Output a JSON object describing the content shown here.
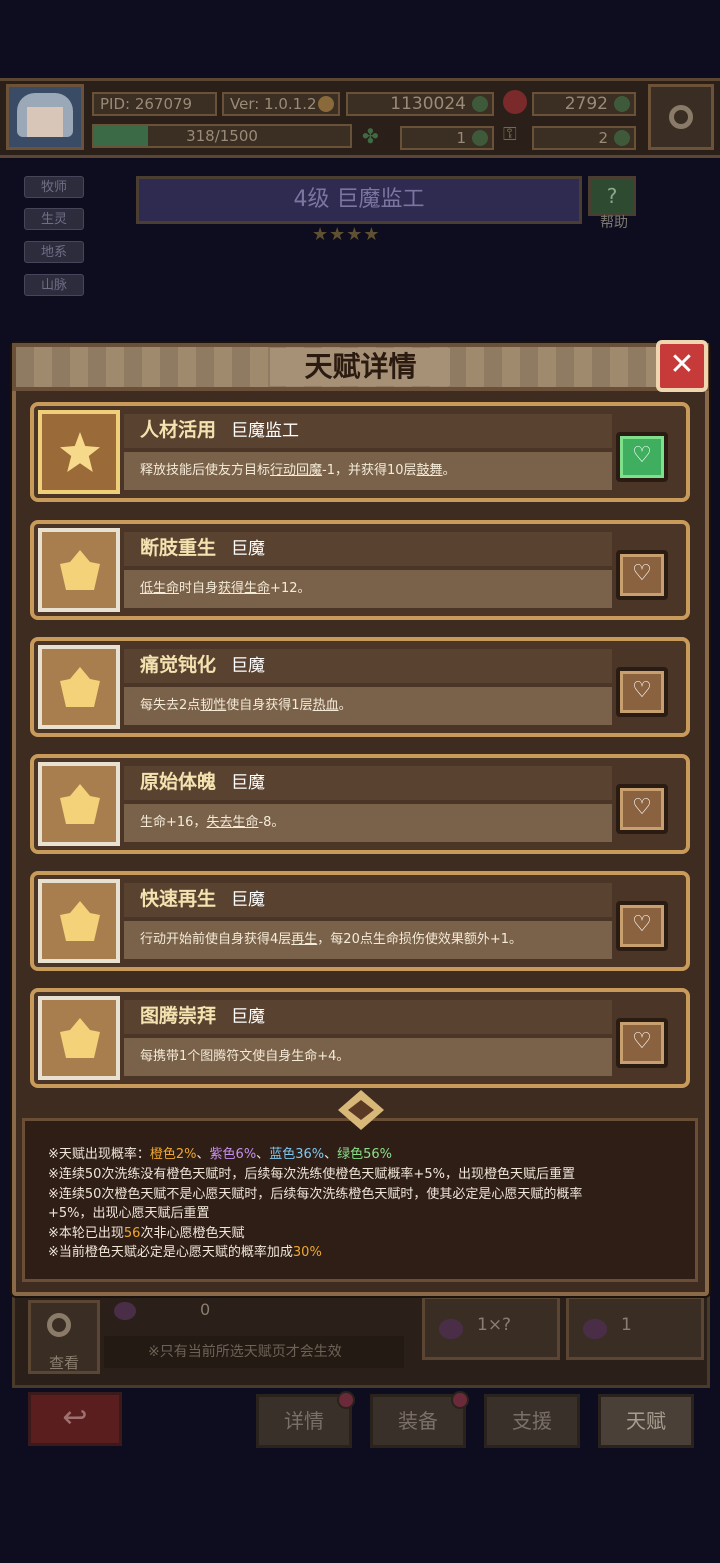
{
  "header": {
    "pid": "PID: 267079",
    "version": "Ver: 1.0.1.2",
    "gold": "1130024",
    "gems": "2792",
    "xp": "318/1500",
    "xp_fraction": 0.212,
    "clovers": "1",
    "keys": "2"
  },
  "side_tags": [
    "牧师",
    "生灵",
    "地系",
    "山脉"
  ],
  "hero": {
    "title": "4级  巨魔监工",
    "stars": "★★★★",
    "help_label": "帮助"
  },
  "modal": {
    "title": "天赋详情",
    "close_icon": "✕",
    "talents": [
      {
        "name": "人材活用",
        "race": "巨魔监工",
        "desc_pre": "释放技能后使友方目标",
        "desc_u1": "行动回魔",
        "desc_mid": "-1，并获得10层",
        "desc_u2": "鼓舞",
        "desc_post": "。",
        "wish": true
      },
      {
        "name": "断肢重生",
        "race": "巨魔",
        "desc_pre": "",
        "desc_u1": "低生命",
        "desc_mid": "时自身",
        "desc_u2": "获得生命",
        "desc_post": "+12。",
        "wish": false
      },
      {
        "name": "痛觉钝化",
        "race": "巨魔",
        "desc_pre": "每失去2点",
        "desc_u1": "韧性",
        "desc_mid": "使自身获得1层",
        "desc_u2": "热血",
        "desc_post": "。",
        "wish": false
      },
      {
        "name": "原始体魄",
        "race": "巨魔",
        "desc_pre": "生命+16，",
        "desc_u1": "失去生命",
        "desc_mid": "-8。",
        "desc_u2": "",
        "desc_post": "",
        "wish": false
      },
      {
        "name": "快速再生",
        "race": "巨魔",
        "desc_pre": "行动开始前使自身获得4层",
        "desc_u1": "再生",
        "desc_mid": "，每20点生命损伤使效果额外+1。",
        "desc_u2": "",
        "desc_post": "",
        "wish": false
      },
      {
        "name": "图腾崇拜",
        "race": "巨魔",
        "desc_pre": "每携带1个图腾符文使自身生命+4。",
        "desc_u1": "",
        "desc_mid": "",
        "desc_u2": "",
        "desc_post": "",
        "wish": false
      }
    ],
    "info": {
      "line1_pre": "※天赋出现概率：",
      "orange": "橙色2%",
      "sep1": "、",
      "purple": "紫色6%",
      "sep2": "、",
      "blue": "蓝色36%",
      "sep3": "、",
      "green": "绿色56%",
      "line2": "※连续50次洗练没有橙色天赋时，后续每次洗练使橙色天赋概率+5%，出现橙色天赋后重置",
      "line3a": "※连续50次橙色天赋不是心愿天赋时，后续每次洗练橙色天赋时，使其必定是心愿天赋的概率",
      "line3b": "+5%，出现心愿天赋后重置",
      "line4_pre": "※本轮已出现",
      "line4_num": "56",
      "line4_post": "次非心愿橙色天赋",
      "line5_pre": "※当前橙色天赋必定是心愿天赋的概率加成",
      "line5_num": "30%"
    }
  },
  "bottom": {
    "view_label": "查看",
    "pot_count": "0",
    "notice": "※只有当前所选天赋页才会生效",
    "auto_value": "1×?",
    "wash_value": "1",
    "back_icon": "↩",
    "tabs": [
      "详情",
      "装备",
      "支援",
      "天赋"
    ]
  },
  "colors": {
    "accent_orange": "#f0a830",
    "purple": "#c890f0",
    "blue": "#80c8f0",
    "green": "#8ae08a",
    "close_red": "#c63a3a",
    "wish_green": "#3fae5e"
  }
}
